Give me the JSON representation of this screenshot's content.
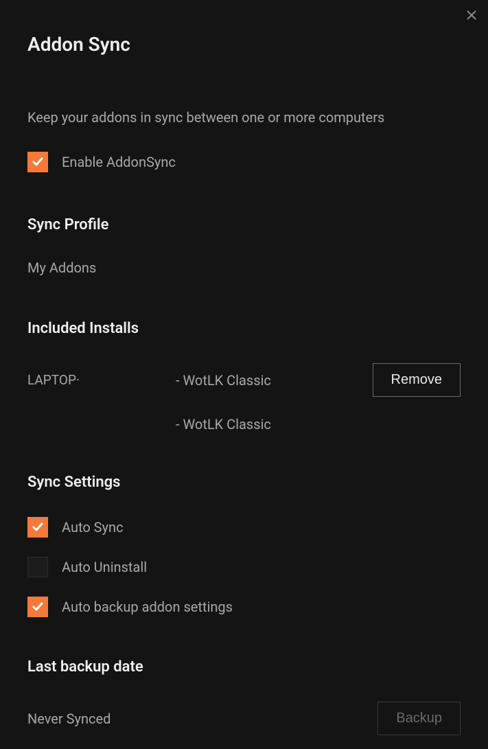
{
  "title": "Addon Sync",
  "description": "Keep your addons in sync between one or more computers",
  "enable": {
    "label": "Enable AddonSync",
    "checked": true
  },
  "profile": {
    "heading": "Sync Profile",
    "name": "My Addons"
  },
  "installs": {
    "heading": "Included Installs",
    "rows": [
      {
        "machine": "LAPTOP·",
        "game": "- WotLK Classic",
        "remove": "Remove"
      },
      {
        "machine": "",
        "game": "- WotLK Classic",
        "remove": ""
      }
    ]
  },
  "settings": {
    "heading": "Sync Settings",
    "items": [
      {
        "label": "Auto Sync",
        "checked": true
      },
      {
        "label": "Auto Uninstall",
        "checked": false
      },
      {
        "label": "Auto backup addon settings",
        "checked": true
      }
    ]
  },
  "backup": {
    "heading": "Last backup date",
    "status": "Never Synced",
    "button": "Backup"
  }
}
